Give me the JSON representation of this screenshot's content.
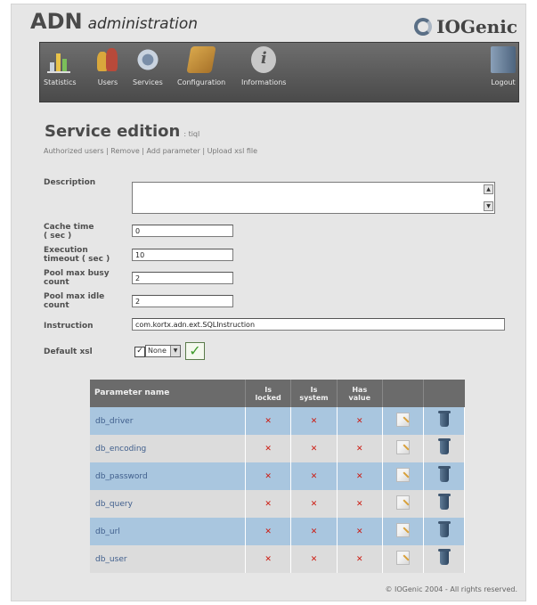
{
  "header": {
    "brand_main": "ADN",
    "brand_sub": "administration",
    "logo_text": "IOGenic"
  },
  "toolbar": {
    "items": [
      {
        "label": "Statistics",
        "icon": "bar-chart-icon"
      },
      {
        "label": "Users",
        "icon": "users-icon"
      },
      {
        "label": "Services",
        "icon": "gear-icon"
      },
      {
        "label": "Configuration",
        "icon": "toolbox-icon"
      },
      {
        "label": "Informations",
        "icon": "info-icon"
      }
    ],
    "logout_label": "Logout"
  },
  "page": {
    "title": "Service edition",
    "subtitle": ": tiql",
    "links": [
      "Authorized users",
      "Remove",
      "Add parameter",
      "Upload xsl file"
    ]
  },
  "form": {
    "description_label": "Description",
    "description_value": "",
    "cache_time_label_1": "Cache time",
    "cache_time_label_2": "( sec )",
    "cache_time_value": "0",
    "exec_timeout_label_1": "Execution",
    "exec_timeout_label_2": "timeout ( sec )",
    "exec_timeout_value": "10",
    "pool_busy_label_1": "Pool max busy",
    "pool_busy_label_2": "count",
    "pool_busy_value": "2",
    "pool_idle_label_1": "Pool max idle",
    "pool_idle_label_2": "count",
    "pool_idle_value": "2",
    "instruction_label": "Instruction",
    "instruction_value": "com.kortx.adn.ext.SQLInstruction",
    "default_xsl_label": "Default xsl",
    "default_xsl_selected": "None",
    "default_xsl_checked": "✓"
  },
  "table": {
    "headers": {
      "name": "Parameter name",
      "locked_1": "Is",
      "locked_2": "locked",
      "system_1": "Is",
      "system_2": "system",
      "value_1": "Has",
      "value_2": "value"
    },
    "rows": [
      {
        "name": "db_driver",
        "locked": "✕",
        "system": "✕",
        "has_value": "✕"
      },
      {
        "name": "db_encoding",
        "locked": "✕",
        "system": "✕",
        "has_value": "✕"
      },
      {
        "name": "db_password",
        "locked": "✕",
        "system": "✕",
        "has_value": "✕"
      },
      {
        "name": "db_query",
        "locked": "✕",
        "system": "✕",
        "has_value": "✕"
      },
      {
        "name": "db_url",
        "locked": "✕",
        "system": "✕",
        "has_value": "✕"
      },
      {
        "name": "db_user",
        "locked": "✕",
        "system": "✕",
        "has_value": "✕"
      }
    ]
  },
  "footer": {
    "text": "© IOGenic 2004 - All rights reserved."
  },
  "colors": {
    "row_odd": "#a9c6df",
    "row_even": "#dcdcdc",
    "header_bg": "#6b6b6b",
    "x_red": "#cc1a10"
  }
}
